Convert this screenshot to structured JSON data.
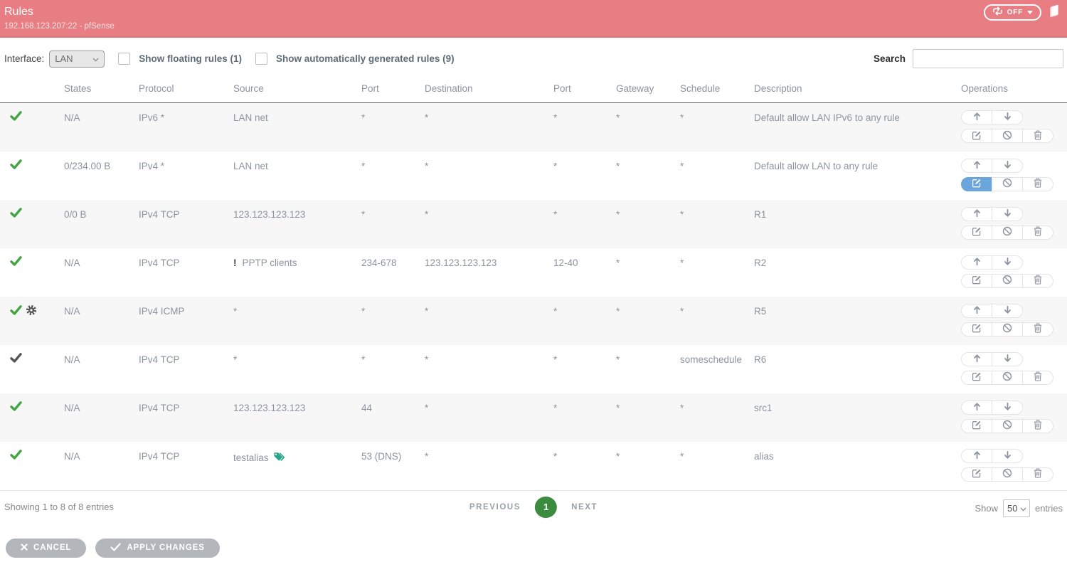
{
  "header": {
    "title": "Rules",
    "subtitle": "192.168.123.207:22 - pfSense",
    "auto_refresh_state": "OFF"
  },
  "toolbar": {
    "interface_label": "Interface:",
    "interface_value": "LAN",
    "floating_rules_label": "Show floating rules (1)",
    "auto_rules_label": "Show automatically generated rules (9)",
    "floating_rules_checked": false,
    "auto_rules_checked": false,
    "search_label": "Search",
    "search_value": ""
  },
  "table": {
    "columns": [
      "",
      "States",
      "Protocol",
      "Source",
      "Port",
      "Destination",
      "Port",
      "Gateway",
      "Schedule",
      "Description",
      "Operations"
    ],
    "rows": [
      {
        "enabled": true,
        "gear": false,
        "states": "N/A",
        "protocol": "IPv6 *",
        "source": "LAN net",
        "negated": false,
        "alias": false,
        "port": "*",
        "destination": "*",
        "dest_port": "*",
        "gateway": "*",
        "schedule": "*",
        "description": "Default allow LAN IPv6 to any rule",
        "active_op": null
      },
      {
        "enabled": true,
        "gear": false,
        "states": "0/234.00 B",
        "protocol": "IPv4 *",
        "source": "LAN net",
        "negated": false,
        "alias": false,
        "port": "*",
        "destination": "*",
        "dest_port": "*",
        "gateway": "*",
        "schedule": "*",
        "description": "Default allow LAN to any rule",
        "active_op": "edit"
      },
      {
        "enabled": true,
        "gear": false,
        "states": "0/0 B",
        "protocol": "IPv4 TCP",
        "source": "123.123.123.123",
        "negated": false,
        "alias": false,
        "port": "*",
        "destination": "*",
        "dest_port": "*",
        "gateway": "*",
        "schedule": "*",
        "description": "R1",
        "active_op": null
      },
      {
        "enabled": true,
        "gear": false,
        "states": "N/A",
        "protocol": "IPv4 TCP",
        "source": "PPTP clients",
        "negated": true,
        "alias": false,
        "port": "234-678",
        "destination": "123.123.123.123",
        "dest_port": "12-40",
        "gateway": "*",
        "schedule": "*",
        "description": "R2",
        "active_op": null
      },
      {
        "enabled": true,
        "gear": true,
        "states": "N/A",
        "protocol": "IPv4 ICMP",
        "source": "*",
        "negated": false,
        "alias": false,
        "port": "*",
        "destination": "*",
        "dest_port": "*",
        "gateway": "*",
        "schedule": "*",
        "description": "R5",
        "active_op": null
      },
      {
        "enabled": false,
        "gear": false,
        "states": "N/A",
        "protocol": "IPv4 TCP",
        "source": "*",
        "negated": false,
        "alias": false,
        "port": "*",
        "destination": "*",
        "dest_port": "*",
        "gateway": "*",
        "schedule": "someschedule",
        "description": "R6",
        "active_op": null
      },
      {
        "enabled": true,
        "gear": false,
        "states": "N/A",
        "protocol": "IPv4 TCP",
        "source": "123.123.123.123",
        "negated": false,
        "alias": false,
        "port": "44",
        "destination": "*",
        "dest_port": "*",
        "gateway": "*",
        "schedule": "*",
        "description": "src1",
        "active_op": null
      },
      {
        "enabled": true,
        "gear": false,
        "states": "N/A",
        "protocol": "IPv4 TCP",
        "source": "testalias",
        "negated": false,
        "alias": true,
        "port": "53 (DNS)",
        "destination": "*",
        "dest_port": "*",
        "gateway": "*",
        "schedule": "*",
        "description": "alias",
        "active_op": null
      }
    ]
  },
  "pagination": {
    "showing": "Showing 1 to 8 of 8 entries",
    "previous_label": "PREVIOUS",
    "current_page": "1",
    "next_label": "NEXT",
    "show_label": "Show",
    "page_size": "50",
    "entries_label": "entries"
  },
  "actions": {
    "cancel_label": "CANCEL",
    "apply_label": "APPLY CHANGES"
  },
  "icons": {
    "header_right": [
      "refresh-icon",
      "caret-down-icon",
      "book-icon"
    ],
    "row_status": [
      "check-icon",
      "gear-icon",
      "tags-icon"
    ],
    "operations": [
      "move-up-icon",
      "move-down-icon",
      "edit-icon",
      "block-icon",
      "trash-icon"
    ],
    "action_bar": [
      "x-icon",
      "check-icon"
    ]
  },
  "colors": {
    "header_bg": "#e87d84",
    "check_green": "#41a541",
    "check_disabled": "#555555",
    "page_green": "#3c8c40",
    "edit_blue": "#6aa5db",
    "tag_green": "#2ba588",
    "btn_gray": "#b3b6ba",
    "text_gray": "#8d939e"
  }
}
